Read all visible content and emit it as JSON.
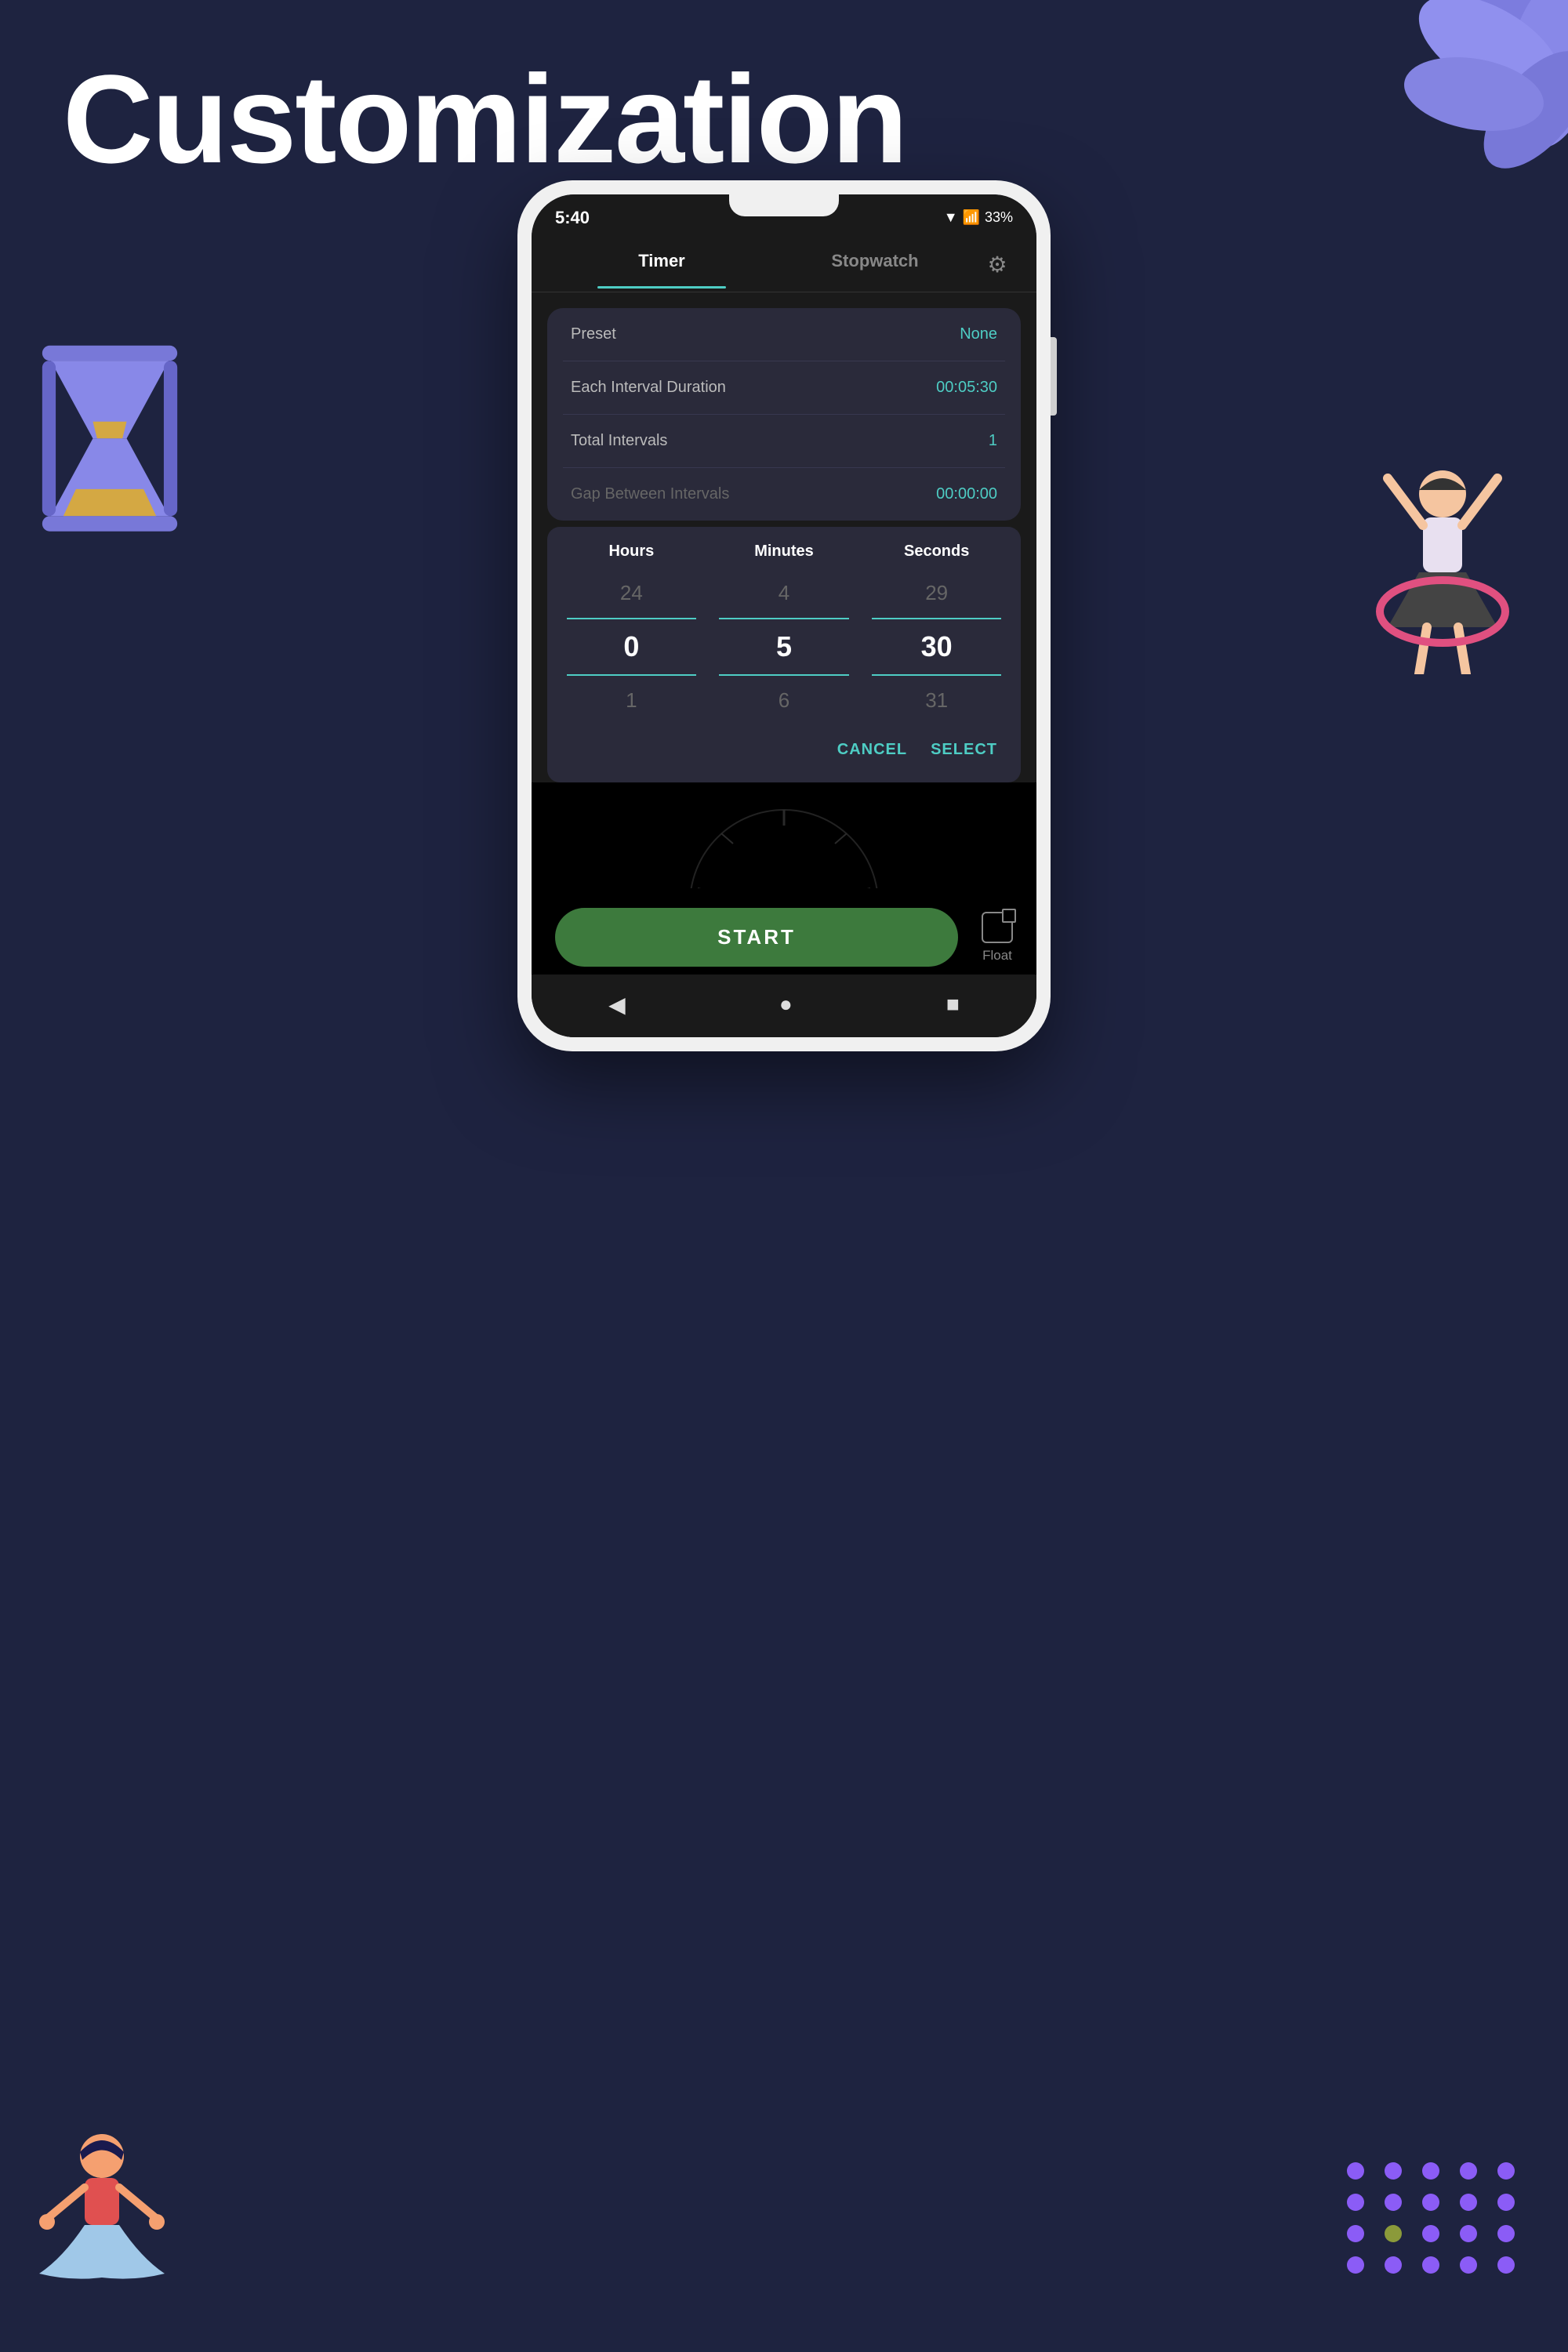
{
  "page": {
    "title": "Customization",
    "background_color": "#1e2340"
  },
  "status_bar": {
    "time": "5:40",
    "battery": "33%"
  },
  "tabs": {
    "timer_label": "Timer",
    "stopwatch_label": "Stopwatch",
    "active": "Timer"
  },
  "settings": {
    "preset_label": "Preset",
    "preset_value": "None",
    "interval_duration_label": "Each Interval Duration",
    "interval_duration_value": "00:05:30",
    "total_intervals_label": "Total Intervals",
    "total_intervals_value": "1",
    "gap_label": "Gap Between Intervals",
    "gap_value": "00:00:00"
  },
  "picker": {
    "hours_label": "Hours",
    "minutes_label": "Minutes",
    "seconds_label": "Seconds",
    "hours_above": "24",
    "hours_selected": "0",
    "hours_below": "1",
    "minutes_above": "4",
    "minutes_selected": "5",
    "minutes_below": "6",
    "seconds_above": "29",
    "seconds_selected": "30",
    "seconds_below": "31",
    "cancel_label": "CANCEL",
    "select_label": "SELECT"
  },
  "bottom": {
    "start_label": "START",
    "float_label": "Float"
  },
  "nav": {
    "back_icon": "◀",
    "home_icon": "●",
    "recent_icon": "■"
  }
}
